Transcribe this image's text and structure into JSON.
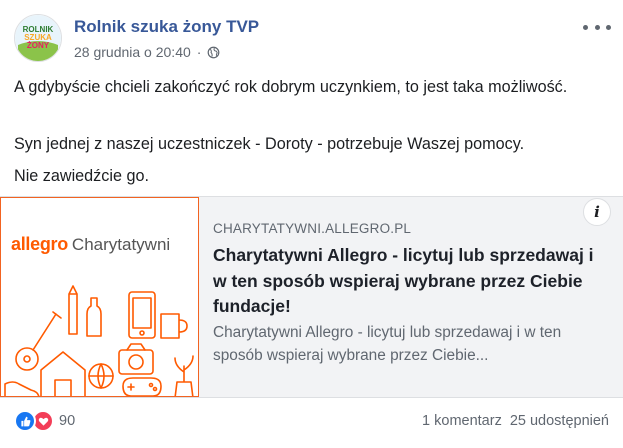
{
  "post": {
    "page_name": "Rolnik szuka żony TVP",
    "avatar_text": [
      "ROLNIK",
      "SZUKA",
      "ŻONY"
    ],
    "timestamp": "28 grudnia o 20:40",
    "separator": "·",
    "privacy_icon": "globe-icon",
    "more_icon": "more-options-icon",
    "paragraphs": [
      "A gdybyście chcieli zakończyć rok dobrym uczynkiem, to jest taka możliwość.",
      "Syn jednej z naszej uczestniczek - Doroty - potrzebuje Waszej pomocy.",
      "Nie zawiedźcie go."
    ]
  },
  "link_card": {
    "brand_name": "allegro",
    "brand_sub": "Charytatywni",
    "domain": "CHARYTATYWNI.ALLEGRO.PL",
    "title": "Charytatywni Allegro - licytuj lub sprzedawaj i w ten sposób wspieraj wybrane przez Ciebie fundacje!",
    "description": "Charytatywni Allegro - licytuj lub sprzedawaj i w ten sposób wspieraj wybrane przez Ciebie...",
    "info_label": "i",
    "accent_color": "#ff5a00"
  },
  "footer": {
    "reaction_icons": [
      "like-icon",
      "love-icon"
    ],
    "reaction_count": "90",
    "comments": "1 komentarz",
    "shares": "25 udostępnień"
  }
}
